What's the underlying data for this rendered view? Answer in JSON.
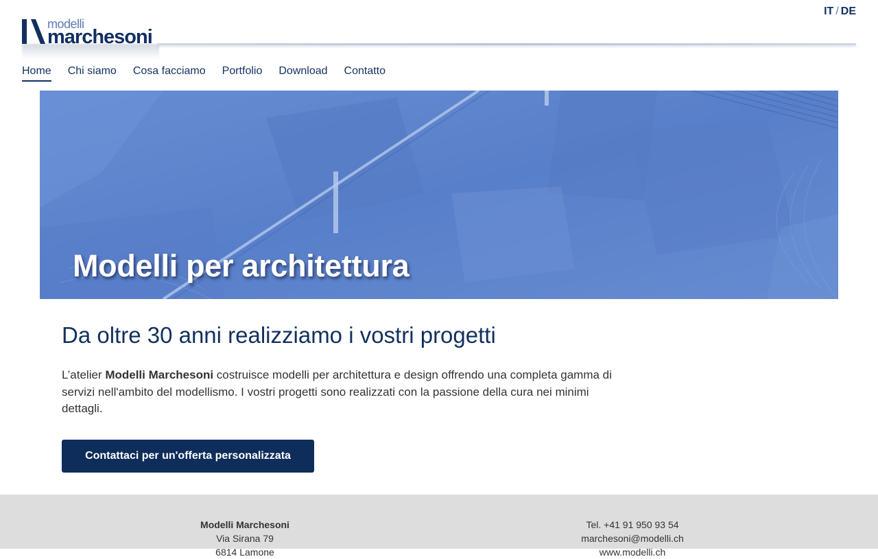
{
  "brand": {
    "small": "modelli",
    "big": "marchesoni"
  },
  "lang": {
    "it": "IT",
    "separator": "/",
    "de": "DE"
  },
  "nav": {
    "items": [
      {
        "label": "Home",
        "active": true
      },
      {
        "label": "Chi siamo"
      },
      {
        "label": "Cosa facciamo"
      },
      {
        "label": "Portfolio"
      },
      {
        "label": "Download"
      },
      {
        "label": "Contatto"
      }
    ]
  },
  "hero": {
    "title": "Modelli per architettura"
  },
  "main": {
    "heading": "Da oltre 30 anni realizziamo i vostri progetti",
    "intro_before": "L’atelier ",
    "intro_bold": "Modelli Marchesoni",
    "intro_after": " costruisce modelli per architettura e design offrendo una completa gamma di servizi nell'ambito del modellismo. I vostri progetti sono realizzati con la passione della cura nei minimi dettagli.",
    "cta": "Contattaci per un'offerta personalizzata"
  },
  "footer": {
    "company": "Modelli Marchesoni",
    "street": "Via Sirana 79",
    "city": "6814 Lamone",
    "phone": "Tel. +41 91 950 93 54",
    "email": "marchesoni@modelli.ch",
    "web": "www.modelli.ch"
  },
  "colors": {
    "navy": "#12305f",
    "hero_blue": "#5f86cf",
    "button": "#0e2d5b",
    "footer_bg": "#dddddd"
  }
}
